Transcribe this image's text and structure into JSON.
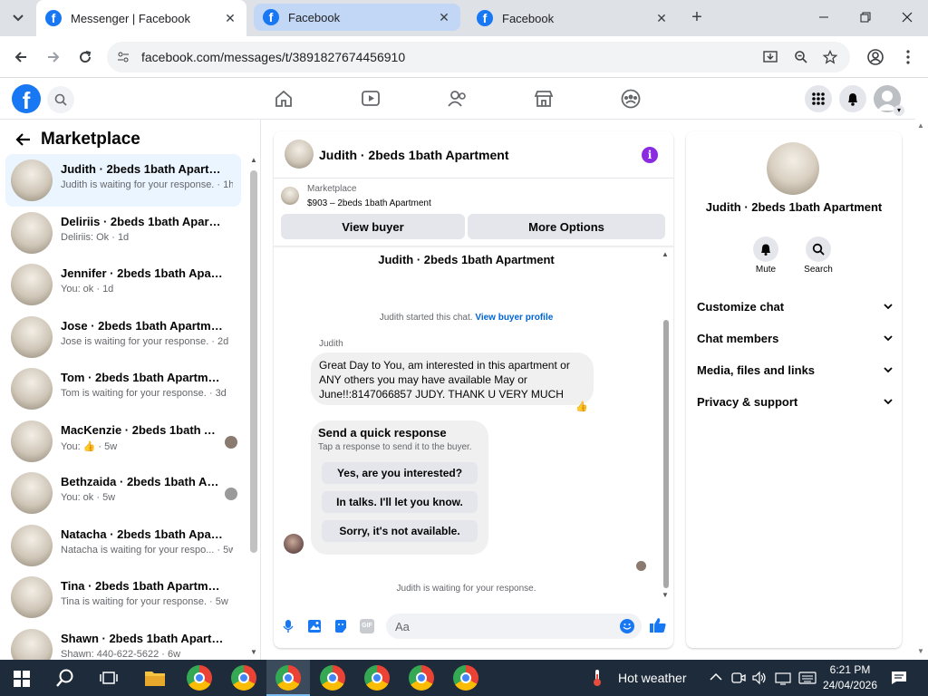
{
  "browser": {
    "tabs": [
      {
        "title": "Messenger | Facebook",
        "active": true
      },
      {
        "title": "Facebook",
        "active": false
      },
      {
        "title": "Facebook",
        "active": false
      }
    ],
    "url": "facebook.com/messages/t/3891827674456910"
  },
  "sidebar": {
    "title": "Marketplace",
    "conversations": [
      {
        "name": "Judith · 2beds 1bath Apartment",
        "preview": "Judith is waiting for your response. · 1h"
      },
      {
        "name": "Deliriis · 2beds 1bath Apartment",
        "preview": "Deliriis: Ok · 1d"
      },
      {
        "name": "Jennifer · 2beds 1bath Apartment",
        "preview": "You: ok · 1d"
      },
      {
        "name": "Jose · 2beds 1bath Apartment",
        "preview": "Jose is waiting for your response. · 2d"
      },
      {
        "name": "Tom · 2beds 1bath Apartment",
        "preview": "Tom is waiting for your response. · 3d"
      },
      {
        "name": "MacKenzie · 2beds 1bath Apa...",
        "preview": "You: 👍 · 5w"
      },
      {
        "name": "Bethzaida · 2beds 1bath Apar...",
        "preview": "You: ok · 5w"
      },
      {
        "name": "Natacha · 2beds 1bath Apartment",
        "preview": "Natacha is waiting for your respo... · 5w"
      },
      {
        "name": "Tina · 2beds 1bath Apartment",
        "preview": "Tina is waiting for your response. · 5w"
      },
      {
        "name": "Shawn · 2beds 1bath Apartment",
        "preview": "Shawn: 440-622-5622 · 6w"
      }
    ]
  },
  "chat": {
    "header_title": "Judith · 2beds 1bath Apartment",
    "listing_label": "Marketplace",
    "listing_detail": "$903 – 2beds 1bath Apartment",
    "view_buyer": "View buyer",
    "more_options": "More Options",
    "thread_title": "Judith · 2beds 1bath Apartment",
    "started_text": "Judith started this chat.",
    "view_buyer_profile": "View buyer profile",
    "sender_name": "Judith",
    "message": "Great Day to You, am interested in this apartment or ANY others you may have available May or June!!:8147066857 JUDY. THANK U VERY MUCH",
    "quick_title": "Send a quick response",
    "quick_sub": "Tap a response to send it to the buyer.",
    "quick_replies": [
      "Yes, are you interested?",
      "In talks. I'll let you know.",
      "Sorry, it's not available."
    ],
    "waiting_text": "Judith is waiting for your response.",
    "composer_placeholder": "Aa"
  },
  "details": {
    "name": "Judith · 2beds 1bath Apartment",
    "mute_label": "Mute",
    "search_label": "Search",
    "sections": [
      "Customize chat",
      "Chat members",
      "Media, files and links",
      "Privacy & support"
    ]
  },
  "taskbar": {
    "weather": "Hot weather",
    "time": "6:21 PM",
    "date": "24/04/2026"
  },
  "colors": {
    "fb_blue": "#1877f2",
    "purple_info": "#8a2be2",
    "taskbar": "#1d2b3a"
  }
}
